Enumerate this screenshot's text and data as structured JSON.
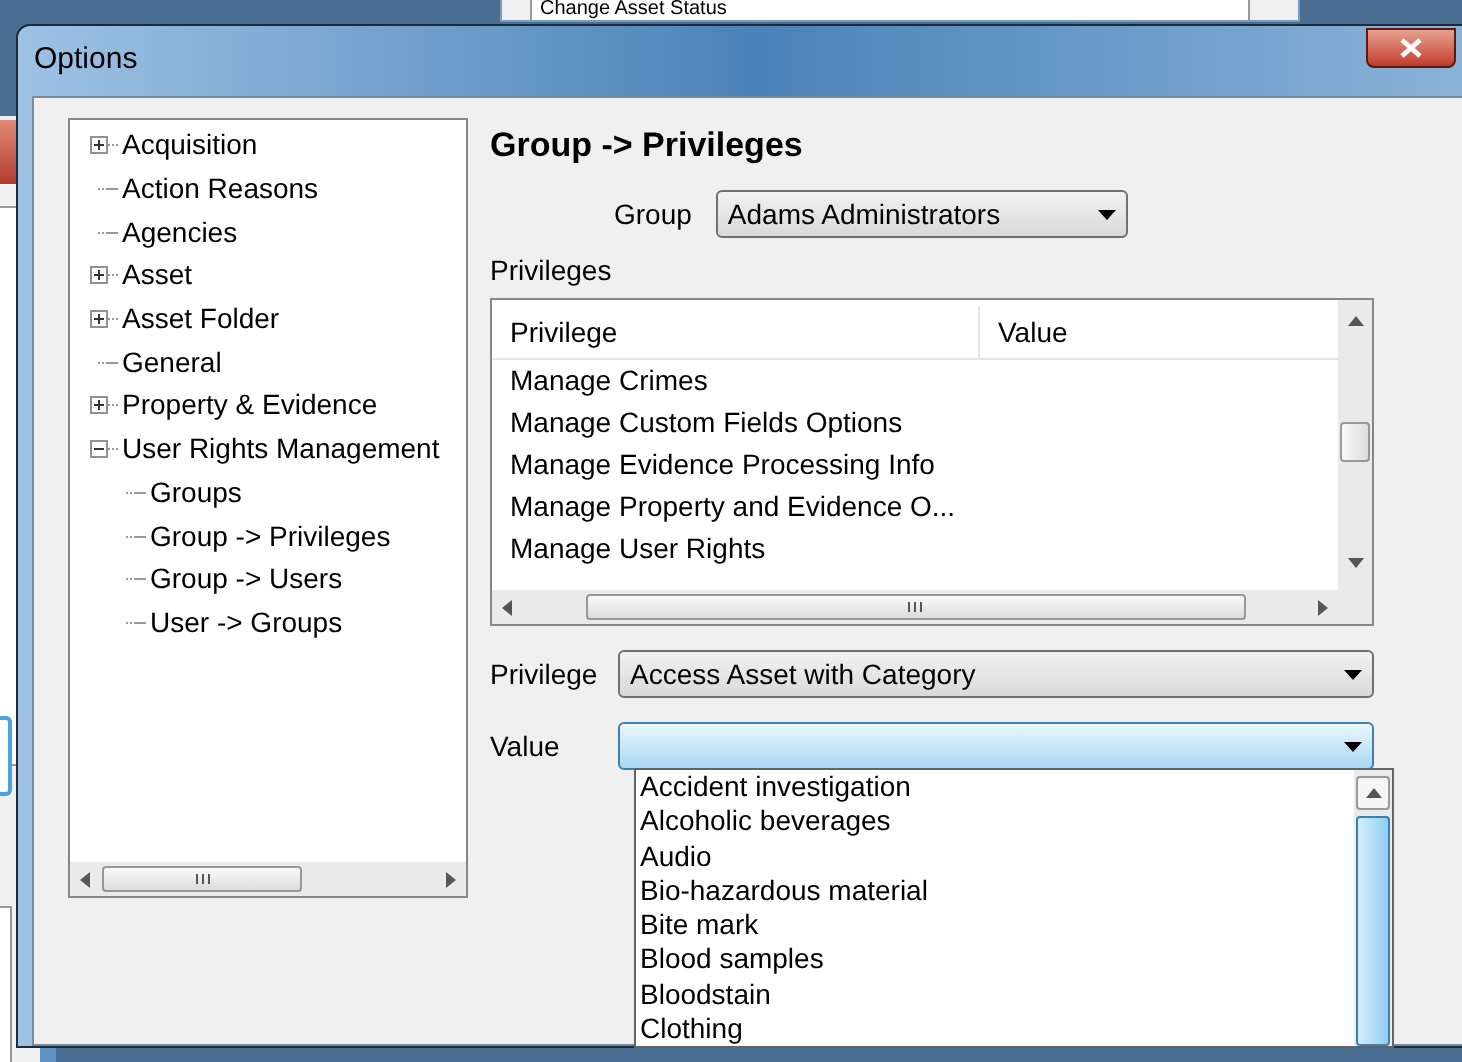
{
  "background_window": {
    "list_item": "Change Asset Status"
  },
  "window": {
    "title": "Options"
  },
  "tree": [
    {
      "label": "Acquisition",
      "expanded": false
    },
    {
      "label": "Action Reasons"
    },
    {
      "label": "Agencies"
    },
    {
      "label": "Asset",
      "expanded": false
    },
    {
      "label": "Asset Folder",
      "expanded": false
    },
    {
      "label": "General"
    },
    {
      "label": "Property & Evidence",
      "expanded": false
    },
    {
      "label": "User Rights Management",
      "expanded": true,
      "children": [
        {
          "label": "Groups"
        },
        {
          "label": "Group -> Privileges"
        },
        {
          "label": "Group -> Users"
        },
        {
          "label": "User -> Groups"
        }
      ]
    }
  ],
  "heading": "Group -> Privileges",
  "group": {
    "label": "Group",
    "value": "Adams Administrators"
  },
  "privileges": {
    "label": "Privileges",
    "columns": [
      "Privilege",
      "Value"
    ],
    "rows": [
      [
        "Manage Crimes",
        ""
      ],
      [
        "Manage Custom Fields Options",
        ""
      ],
      [
        "Manage Evidence Processing Info",
        ""
      ],
      [
        "Manage Property and Evidence O...",
        ""
      ],
      [
        "Manage User Rights",
        ""
      ]
    ]
  },
  "privilege": {
    "label": "Privilege",
    "value": "Access Asset with Category"
  },
  "value": {
    "label": "Value",
    "focused": true,
    "open": true,
    "options": [
      "Accident investigation",
      "Alcoholic beverages",
      "Audio",
      "Bio-hazardous material",
      "Bite mark",
      "Blood samples",
      "Bloodstain",
      "Clothing"
    ]
  }
}
